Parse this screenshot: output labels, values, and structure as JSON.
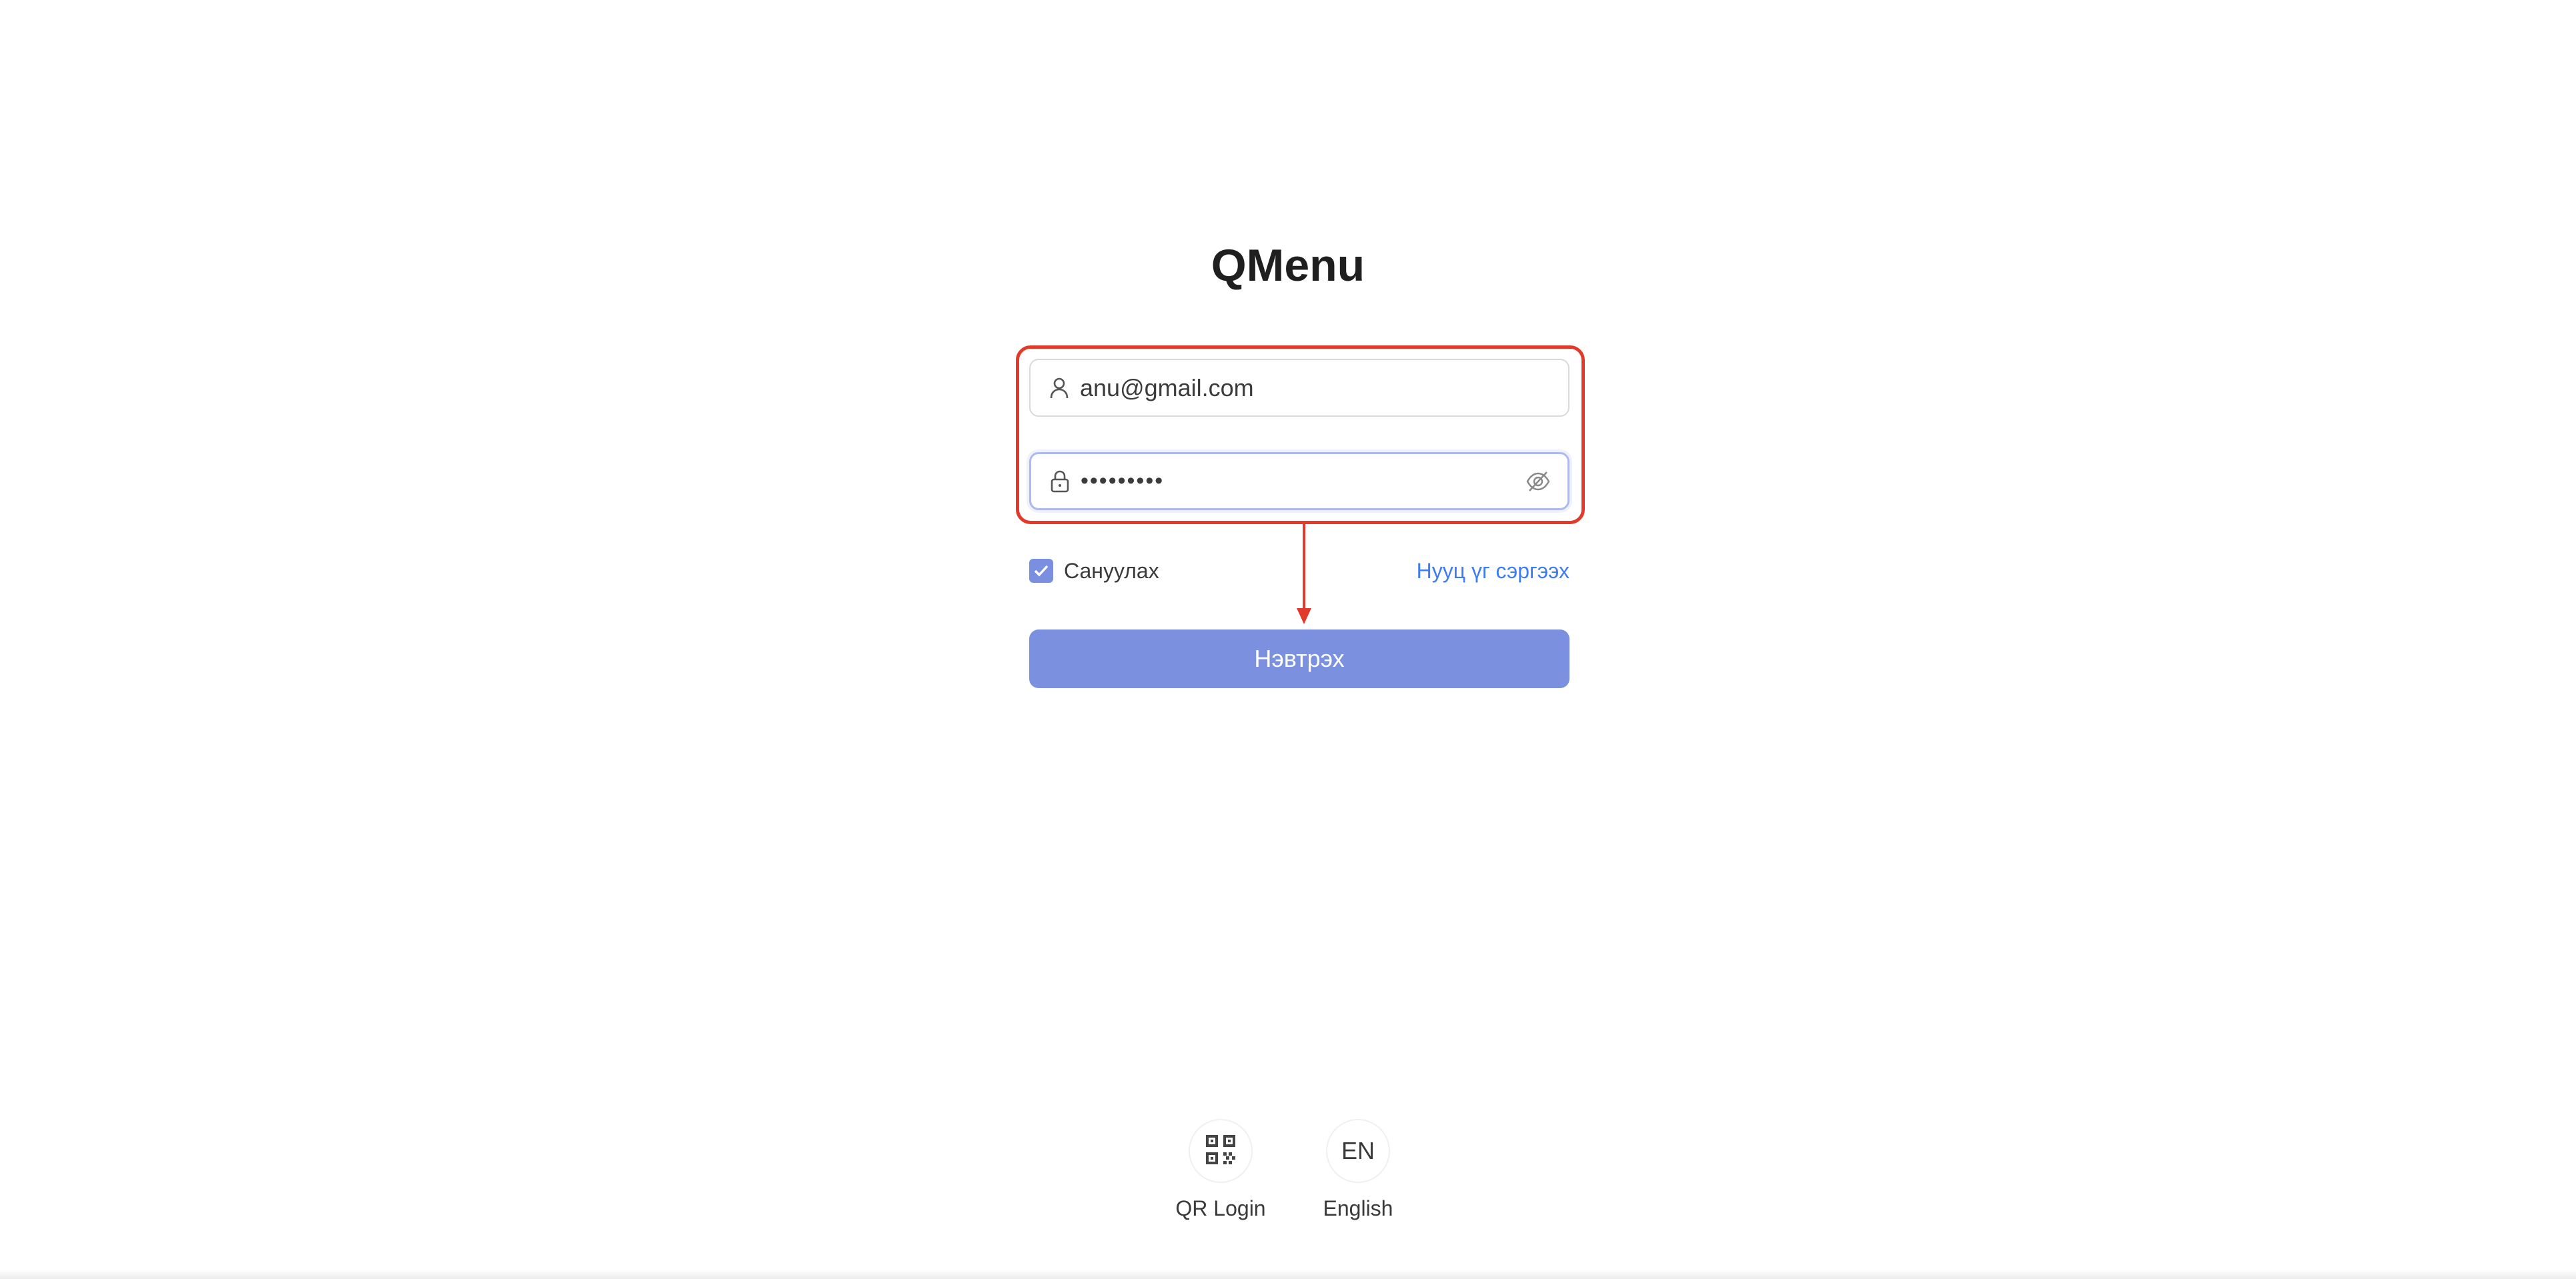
{
  "app": {
    "title": "QMenu"
  },
  "form": {
    "username_value": "anu@gmail.com",
    "password_value": "•••••••••",
    "remember_label": "Сануулах",
    "remember_checked": true,
    "forgot_label": "Нууц үг сэргээх",
    "submit_label": "Нэвтрэх"
  },
  "footer": {
    "qr_label": "QR Login",
    "lang_code": "EN",
    "lang_label": "English"
  },
  "colors": {
    "primary": "#7b91e0",
    "link": "#3d7cf2",
    "annotation": "#e23a2a"
  },
  "icons": {
    "user": "user-icon",
    "lock": "lock-icon",
    "eye": "eye-off-icon",
    "check": "check-icon",
    "qr": "qr-code-icon"
  }
}
